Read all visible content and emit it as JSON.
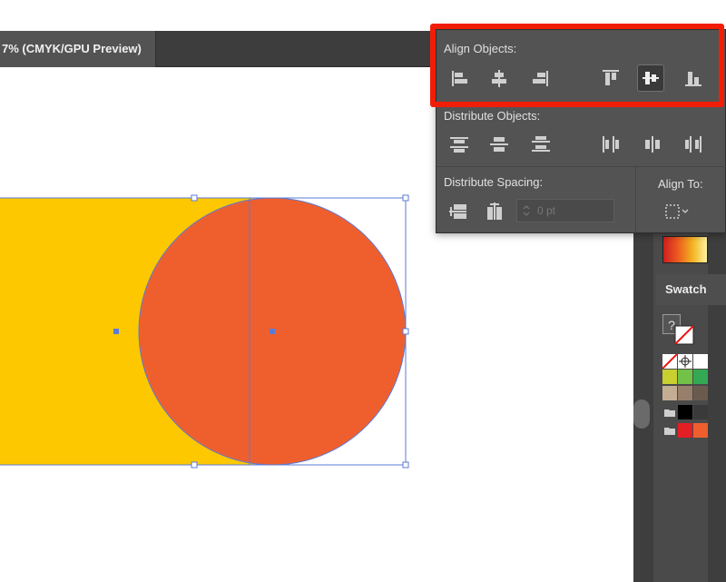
{
  "app": {
    "document_tab_title": "7% (CMYK/GPU Preview)"
  },
  "align_panel": {
    "align_objects": {
      "label": "Align Objects:",
      "buttons": [
        "horizontal-align-left-icon",
        "horizontal-align-center-icon",
        "horizontal-align-right-icon",
        "vertical-align-top-icon",
        "vertical-align-center-icon",
        "vertical-align-bottom-icon"
      ],
      "selected": "vertical-align-center-icon"
    },
    "distribute_objects": {
      "label": "Distribute Objects:",
      "buttons": [
        "vertical-distribute-top-icon",
        "vertical-distribute-center-icon",
        "vertical-distribute-bottom-icon",
        "horizontal-distribute-left-icon",
        "horizontal-distribute-center-icon",
        "horizontal-distribute-right-icon"
      ]
    },
    "distribute_spacing": {
      "label": "Distribute Spacing:",
      "spacing_value": "0 pt",
      "buttons": [
        "vertical-distribute-space-icon",
        "horizontal-distribute-space-icon"
      ]
    },
    "align_to": {
      "label": "Align To:",
      "icon": "align-to-selection-icon"
    }
  },
  "swatches_panel": {
    "tab_label": "Swatch",
    "help_glyph": "?"
  },
  "artwork": {
    "rectangle_color": "#fdc800",
    "circle_color": "#ef5f2e",
    "selection_color": "#5b7bd5"
  },
  "highlight_color": "#f21d06"
}
